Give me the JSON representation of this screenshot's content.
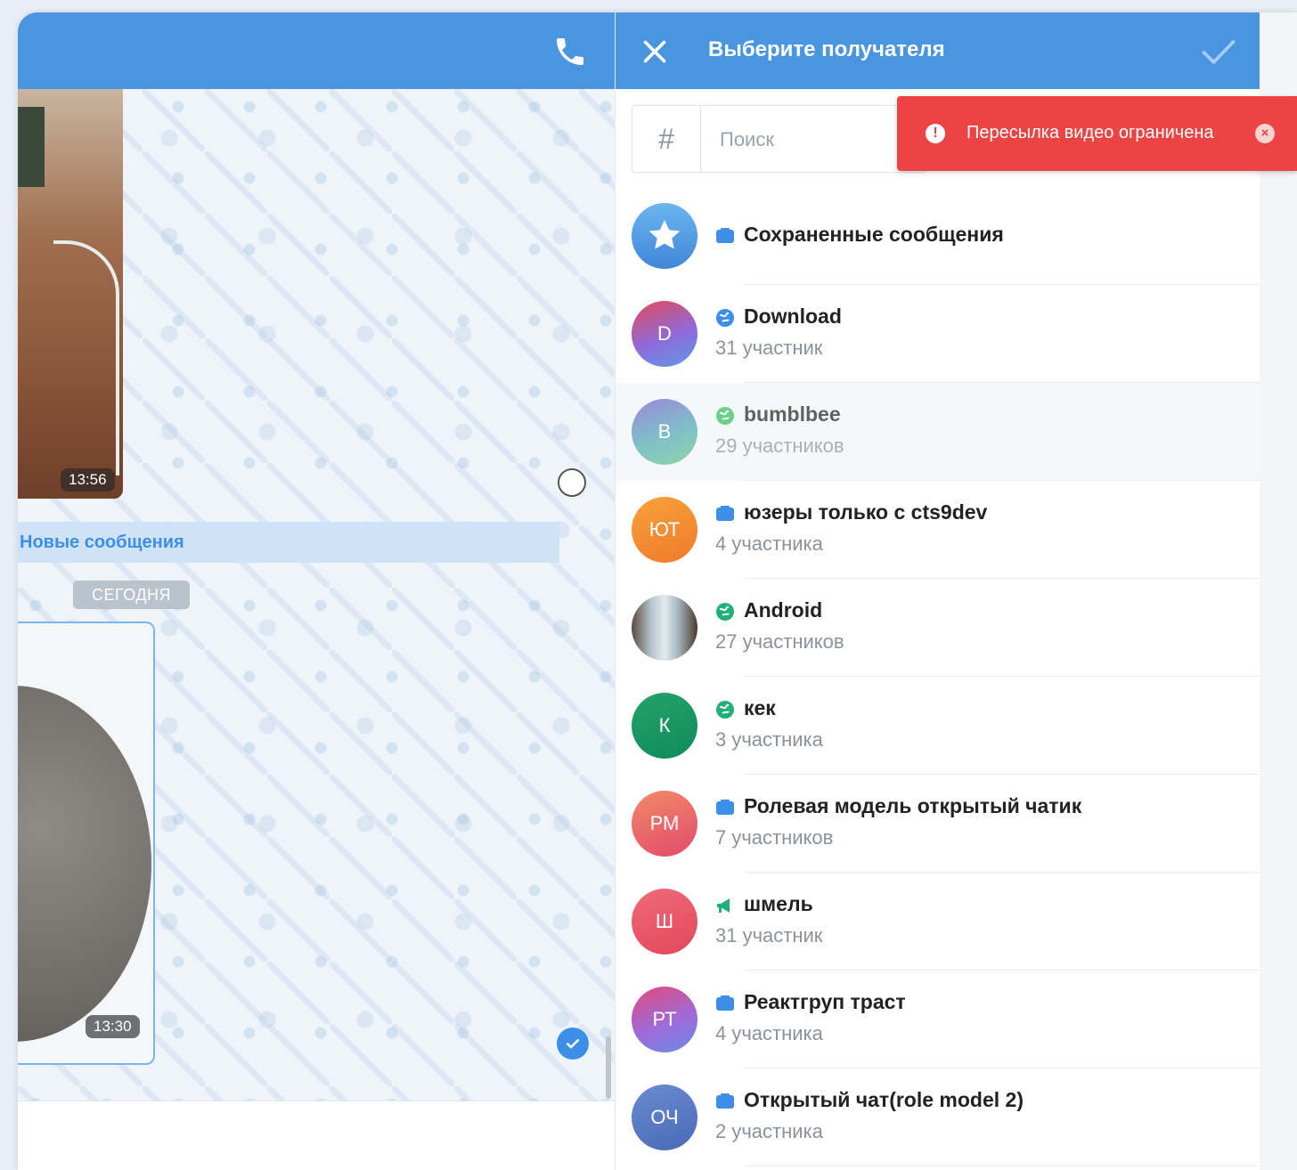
{
  "chat": {
    "times": [
      "13:56",
      "13:30"
    ],
    "new_messages_label": "Новые сообщения",
    "date_chip": "СЕГОДНЯ"
  },
  "forward": {
    "title": "Выберите получателя",
    "search": {
      "hash": "#",
      "placeholder": "Поиск"
    },
    "toast": "Пересылка видео ограничена",
    "items": [
      {
        "title": "Сохраненные сообщения",
        "subtitle": "",
        "avatar_text": "",
        "kind": "chat-icon",
        "avatar": "star-icon"
      },
      {
        "title": "Download",
        "subtitle": "31 участник",
        "avatar_text": "D",
        "kind": "globe-icon"
      },
      {
        "title": "bumblbee",
        "subtitle": "29 участников",
        "avatar_text": "B",
        "kind": "globe-icon"
      },
      {
        "title": "юзеры только с cts9dev",
        "subtitle": "4 участника",
        "avatar_text": "ЮТ",
        "kind": "chat-icon"
      },
      {
        "title": "Android",
        "subtitle": "27 участников",
        "avatar_text": "",
        "kind": "globe-icon",
        "avatar": "photo"
      },
      {
        "title": "кек",
        "subtitle": "3 участника",
        "avatar_text": "К",
        "kind": "globe-icon"
      },
      {
        "title": "Ролевая модель открытый чатик",
        "subtitle": "7 участников",
        "avatar_text": "РМ",
        "kind": "chat-icon"
      },
      {
        "title": "шмель",
        "subtitle": "31 участник",
        "avatar_text": "Ш",
        "kind": "megaphone-icon"
      },
      {
        "title": "Реактгруп траст",
        "subtitle": "4 участника",
        "avatar_text": "РТ",
        "kind": "chat-icon"
      },
      {
        "title": "Открытый чат(role model 2)",
        "subtitle": "2 участника",
        "avatar_text": "ОЧ",
        "kind": "chat-icon"
      }
    ]
  },
  "colors": {
    "header": "#4a95e0",
    "toast": "#ec4444",
    "accent": "#3d8ee6"
  }
}
